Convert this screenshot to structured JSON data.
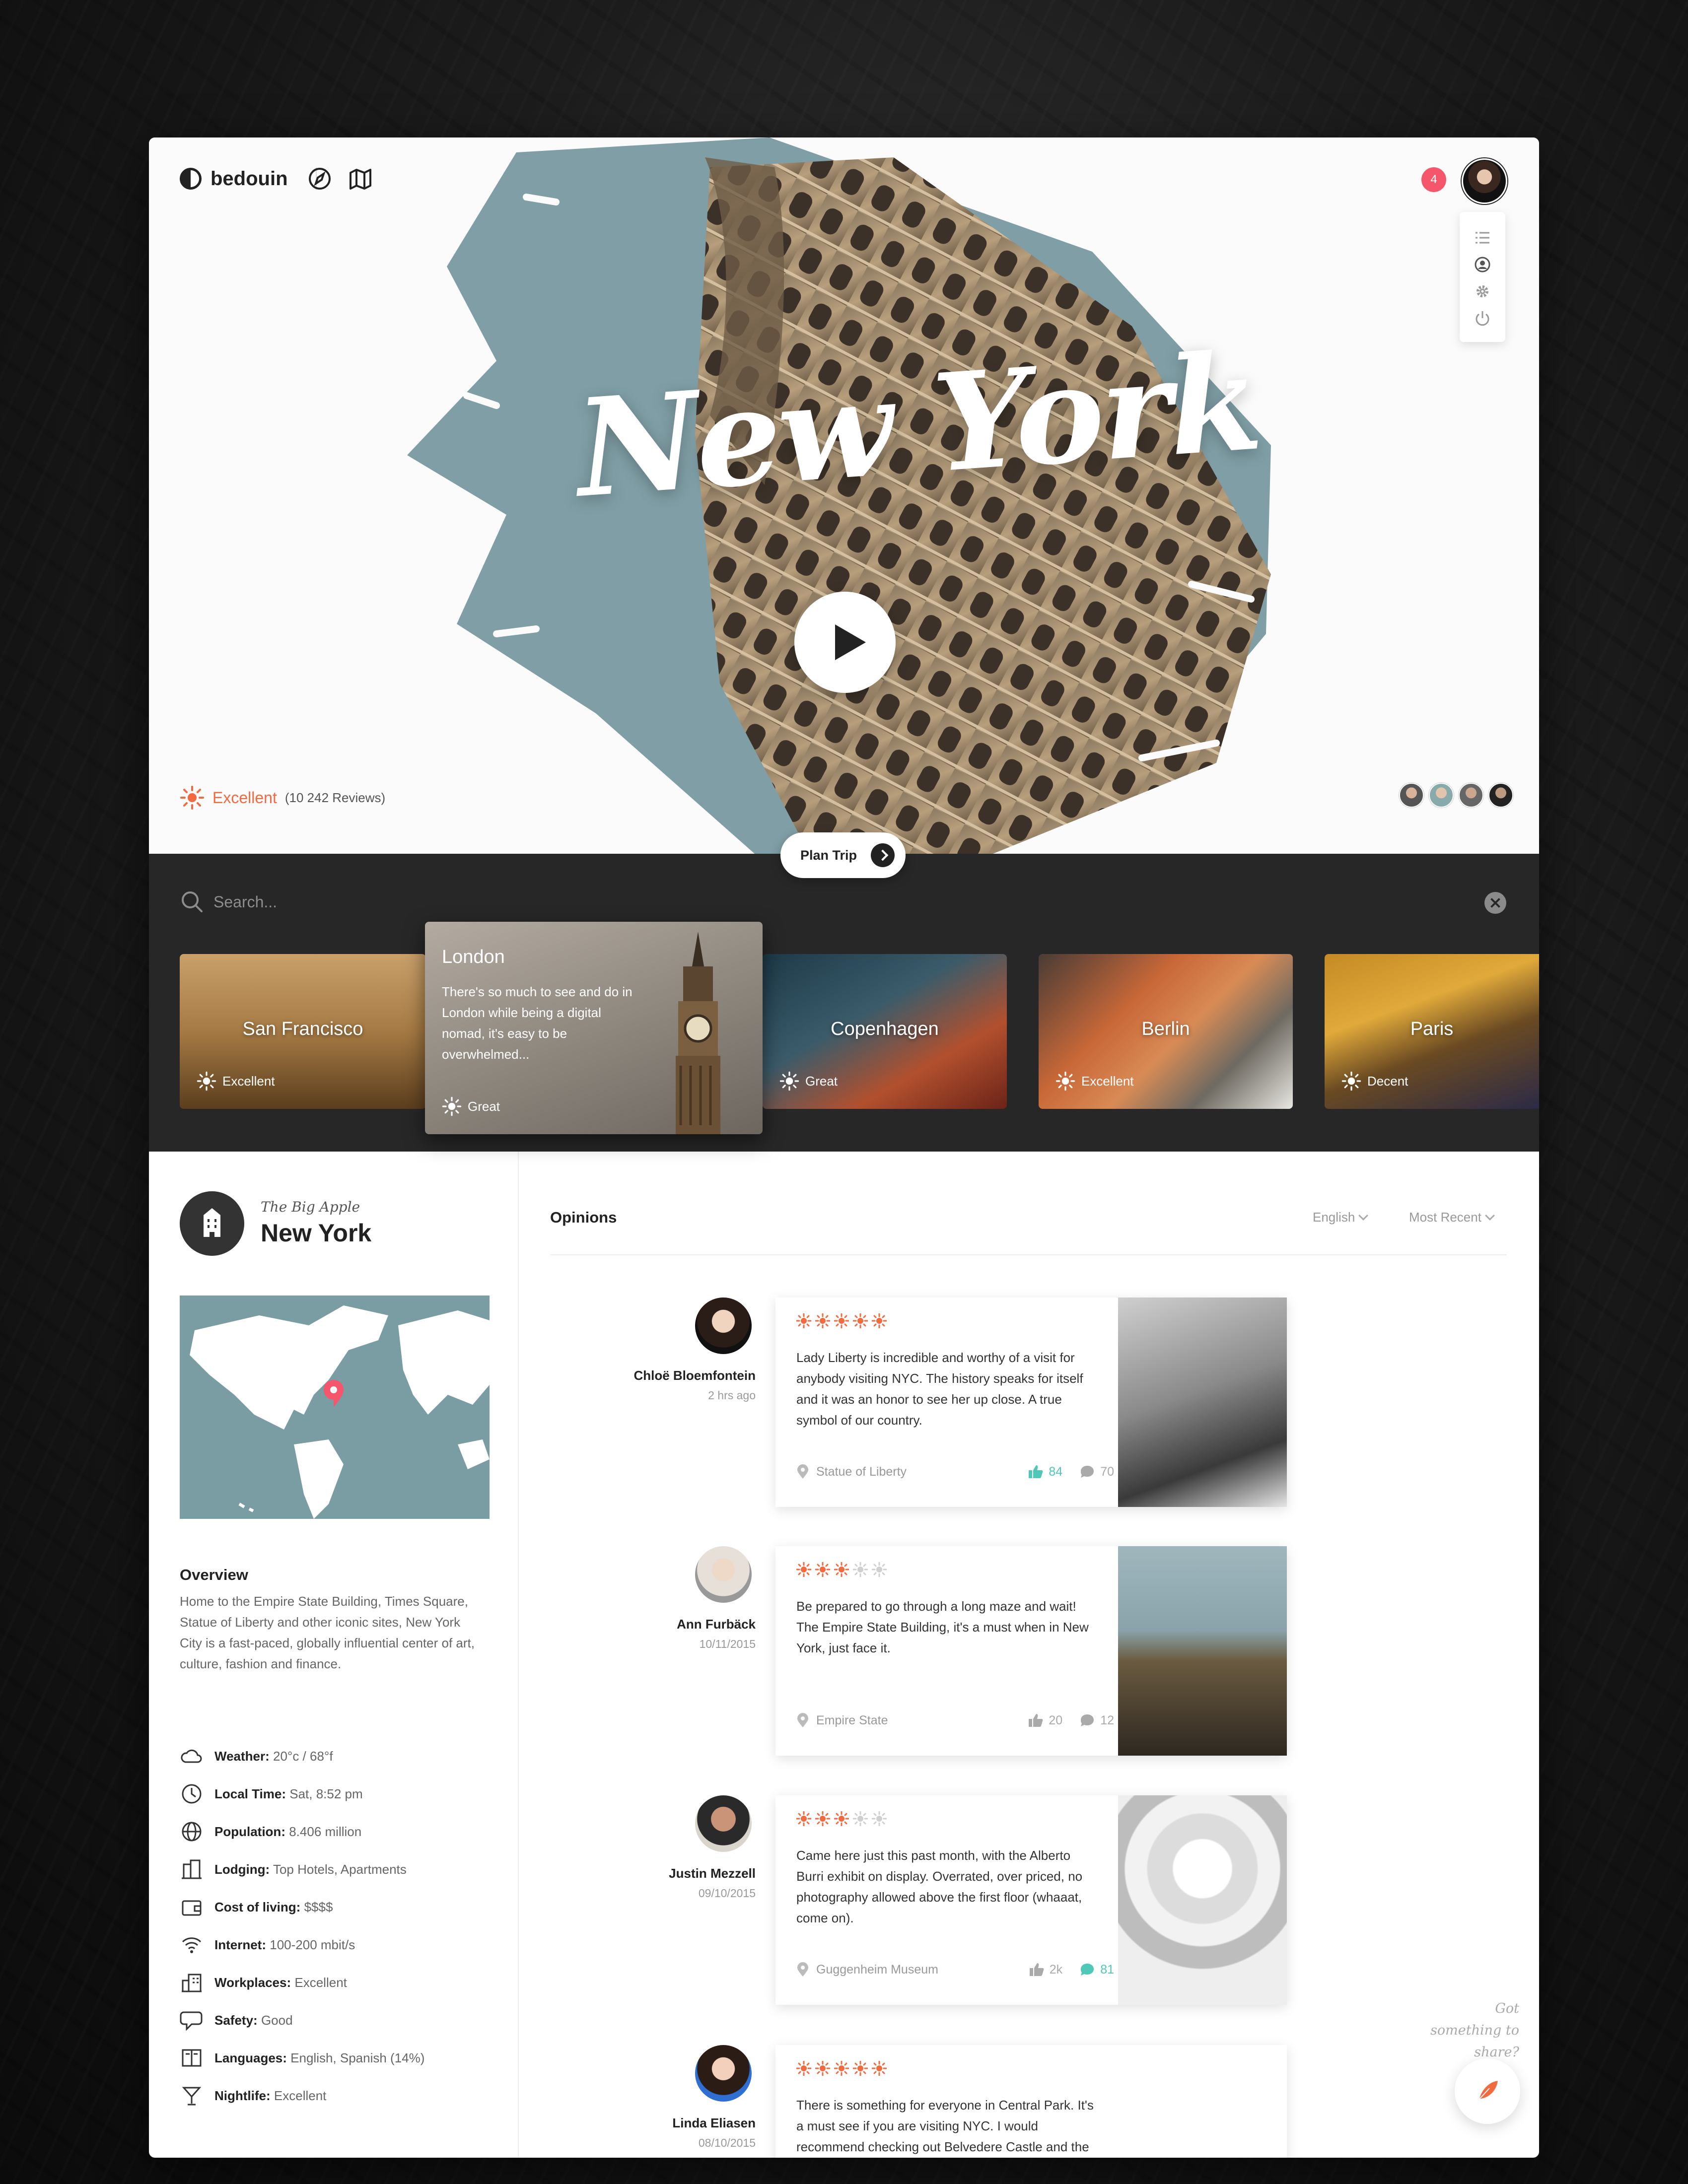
{
  "app": {
    "brand": "bedouin",
    "notifications": "4"
  },
  "hero": {
    "city_title": "New York",
    "rating_label": "Excellent",
    "rating_count": "(10 242 Reviews)",
    "plan_trip": "Plan Trip",
    "icons": [
      "compass-icon",
      "map-icon",
      "list-icon",
      "user-icon",
      "gear-icon",
      "power-icon"
    ]
  },
  "search": {
    "placeholder": "Search..."
  },
  "destinations": [
    {
      "name": "San Francisco",
      "rating": "Excellent"
    },
    {
      "name": "London",
      "rating": "Great",
      "description": "There's so much to see and do in London while being a digital nomad, it's easy to be overwhelmed..."
    },
    {
      "name": "Copenhagen",
      "rating": "Great"
    },
    {
      "name": "Berlin",
      "rating": "Excellent"
    },
    {
      "name": "Paris",
      "rating": "Decent"
    }
  ],
  "city": {
    "nickname": "The Big Apple",
    "name": "New York",
    "overview_heading": "Overview",
    "overview": "Home to the Empire State Building, Times Square, Statue of Liberty and other iconic sites, New York City is a fast-paced, globally influential center of art, culture, fashion and finance.",
    "facts": [
      {
        "key": "Weather:",
        "value": "20°c / 68°f",
        "icon": "weather-icon"
      },
      {
        "key": "Local Time:",
        "value": "Sat, 8:52 pm",
        "icon": "clock-icon"
      },
      {
        "key": "Population:",
        "value": "8.406 million",
        "icon": "globe-icon"
      },
      {
        "key": "Lodging:",
        "value": "Top Hotels, Apartments",
        "icon": "hotel-icon"
      },
      {
        "key": "Cost of living:",
        "value": "$$$$",
        "icon": "wallet-icon"
      },
      {
        "key": "Internet:",
        "value": "100-200 mbit/s",
        "icon": "wifi-icon"
      },
      {
        "key": "Workplaces:",
        "value": "Excellent",
        "icon": "office-icon"
      },
      {
        "key": "Safety:",
        "value": "Good",
        "icon": "safety-icon"
      },
      {
        "key": "Languages:",
        "value": "English, Spanish (14%)",
        "icon": "book-icon"
      },
      {
        "key": "Nightlife:",
        "value": "Excellent",
        "icon": "cocktail-icon"
      }
    ]
  },
  "opinions": {
    "heading": "Opinions",
    "language": "English",
    "sort": "Most Recent",
    "reviews": [
      {
        "name": "Chloë Bloemfontein",
        "date": "2 hrs ago",
        "stars": 5,
        "text": "Lady Liberty is incredible and worthy of a visit for anybody visiting NYC.  The history speaks for itself and it was an honor to see her up close.  A true symbol of our country.",
        "location": "Statue of Liberty",
        "likes": "84",
        "comments": "70",
        "liked": true,
        "commented": false
      },
      {
        "name": "Ann Furbäck",
        "date": "10/11/2015",
        "stars": 3,
        "text": "Be prepared to go through a long maze and wait! The Empire State Building, it's a must when in New York, just face it.",
        "location": "Empire State",
        "likes": "20",
        "comments": "12",
        "liked": false,
        "commented": false
      },
      {
        "name": "Justin Mezzell",
        "date": "09/10/2015",
        "stars": 3,
        "text": "Came here just this past month, with the Alberto Burri exhibit on display. Overrated, over priced, no photography allowed above the first floor (whaaat, come on).",
        "location": "Guggenheim Museum",
        "likes": "2k",
        "comments": "81",
        "liked": false,
        "commented": true
      },
      {
        "name": "Linda Eliasen",
        "date": "08/10/2015",
        "stars": 5,
        "text": "There is something for everyone in Central Park. It's a must see if you are visiting NYC. I would recommend checking out Belvedere Castle and the Shakespeare Garden."
      }
    ]
  },
  "share": {
    "prompt": "Got something to share?"
  },
  "colors": {
    "accent": "#f26a3f",
    "teal": "#4fc8b8",
    "notif": "#f5566c",
    "dark": "#272727"
  }
}
